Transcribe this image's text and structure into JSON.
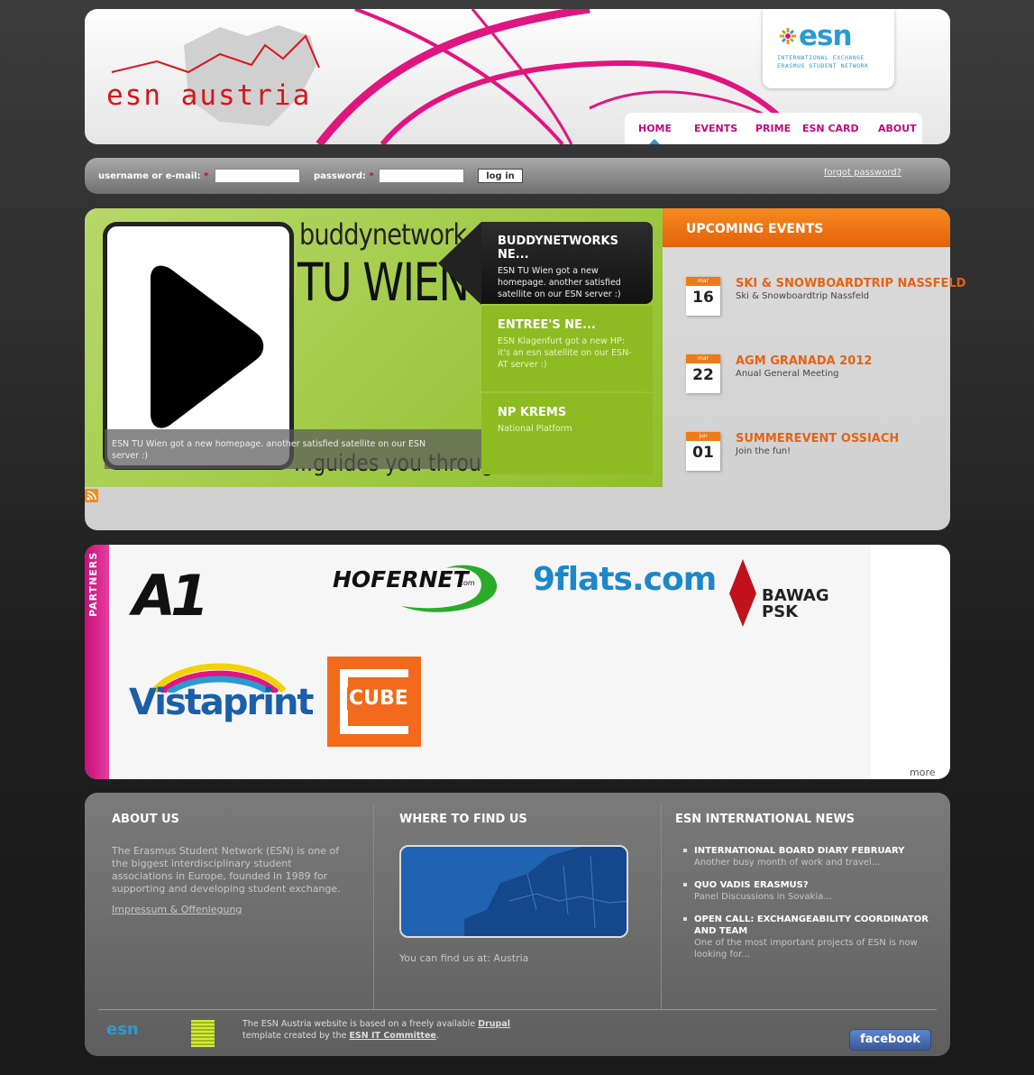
{
  "header": {
    "logo_text": "esn austria",
    "esn_logo": {
      "word": "esn",
      "tagline_1": "INTERNATIONAL EXCHANGE",
      "tagline_2": "ERASMUS STUDENT NETWORK"
    },
    "nav": [
      {
        "label": "HOME",
        "active": true
      },
      {
        "label": "EVENTS"
      },
      {
        "label": "PRIME"
      },
      {
        "label": "ESN CARD"
      },
      {
        "label": "ABOUT"
      }
    ]
  },
  "login": {
    "username_label": "username or e-mail:",
    "password_label": "password:",
    "required_mark": "*",
    "username_value": "",
    "password_value": "",
    "button_label": "log in",
    "forgot_label": "forgot password?"
  },
  "slider": {
    "slide_title_1": "buddynetwork",
    "slide_title_2": "TU WIEN",
    "slide_title_3": "...guides you through",
    "caption": "ESN TU Wien got a new homepage. another satisfied satellite on our ESN server :)",
    "tabs": [
      {
        "title": "BUDDYNETWORKS NE...",
        "text": "ESN TU Wien got a new homepage. another satisfied satellite on our ESN server :)"
      },
      {
        "title": "ENTREE'S NE...",
        "text": "ESN Klagenfurt got a new HP: it's an esn satellite on our ESN-AT server :)"
      },
      {
        "title": "NP KREMS",
        "text": "National Platform"
      }
    ]
  },
  "events": {
    "heading": "UPCOMING EVENTS",
    "items": [
      {
        "month": "mar",
        "day": "16",
        "title": "SKI & SNOWBOARDTRIP NASSFELD",
        "subtitle": "Ski & Snowboardtrip Nassfeld"
      },
      {
        "month": "mar",
        "day": "22",
        "title": "AGM GRANADA 2012",
        "subtitle": "Anual General Meeting"
      },
      {
        "month": "jun",
        "day": "01",
        "title": "SUMMEREVENT OSSIACH",
        "subtitle": "Join the fun!"
      }
    ]
  },
  "partners": {
    "heading": "PARTNERS",
    "logos": [
      "A1",
      "HOFERNET",
      ".com",
      "9flats.com",
      "BAWAG",
      "PSK",
      "Vistaprint",
      "CUBE"
    ],
    "more_label": "more"
  },
  "footer": {
    "about": {
      "title": "ABOUT US",
      "text": "The Erasmus Student Network (ESN) is one of the biggest interdisciplinary student associations in Europe, founded in 1989 for supporting and developing student exchange.",
      "link": "Impressum & Offenlegung"
    },
    "find": {
      "title": "WHERE TO FIND US",
      "text": "You can find us at: Austria"
    },
    "news": {
      "title": "ESN INTERNATIONAL NEWS",
      "items": [
        {
          "title": "INTERNATIONAL BOARD DIARY FEBRUARY",
          "text": "Another busy month of work and travel..."
        },
        {
          "title": "QUO VADIS ERASMUS?",
          "text": "Panel Discussions in Sovakia..."
        },
        {
          "title": "OPEN CALL: EXCHANGEABILITY COORDINATOR AND TEAM",
          "text": "One of the most important projects of ESN is now looking for..."
        }
      ]
    },
    "credit_pre": "The ESN Austria website is based on a freely available",
    "credit_drupal": "Drupal",
    "credit_mid": "template created by the",
    "credit_team": "ESN IT Committee",
    "credit_end": ".",
    "esn_small": "esn",
    "facebook_label": "facebook"
  },
  "colors": {
    "accent_pink": "#c2087a",
    "esn_blue": "#2b9ad2",
    "event_orange": "#e46314",
    "slider_green": "#8dbb22"
  }
}
